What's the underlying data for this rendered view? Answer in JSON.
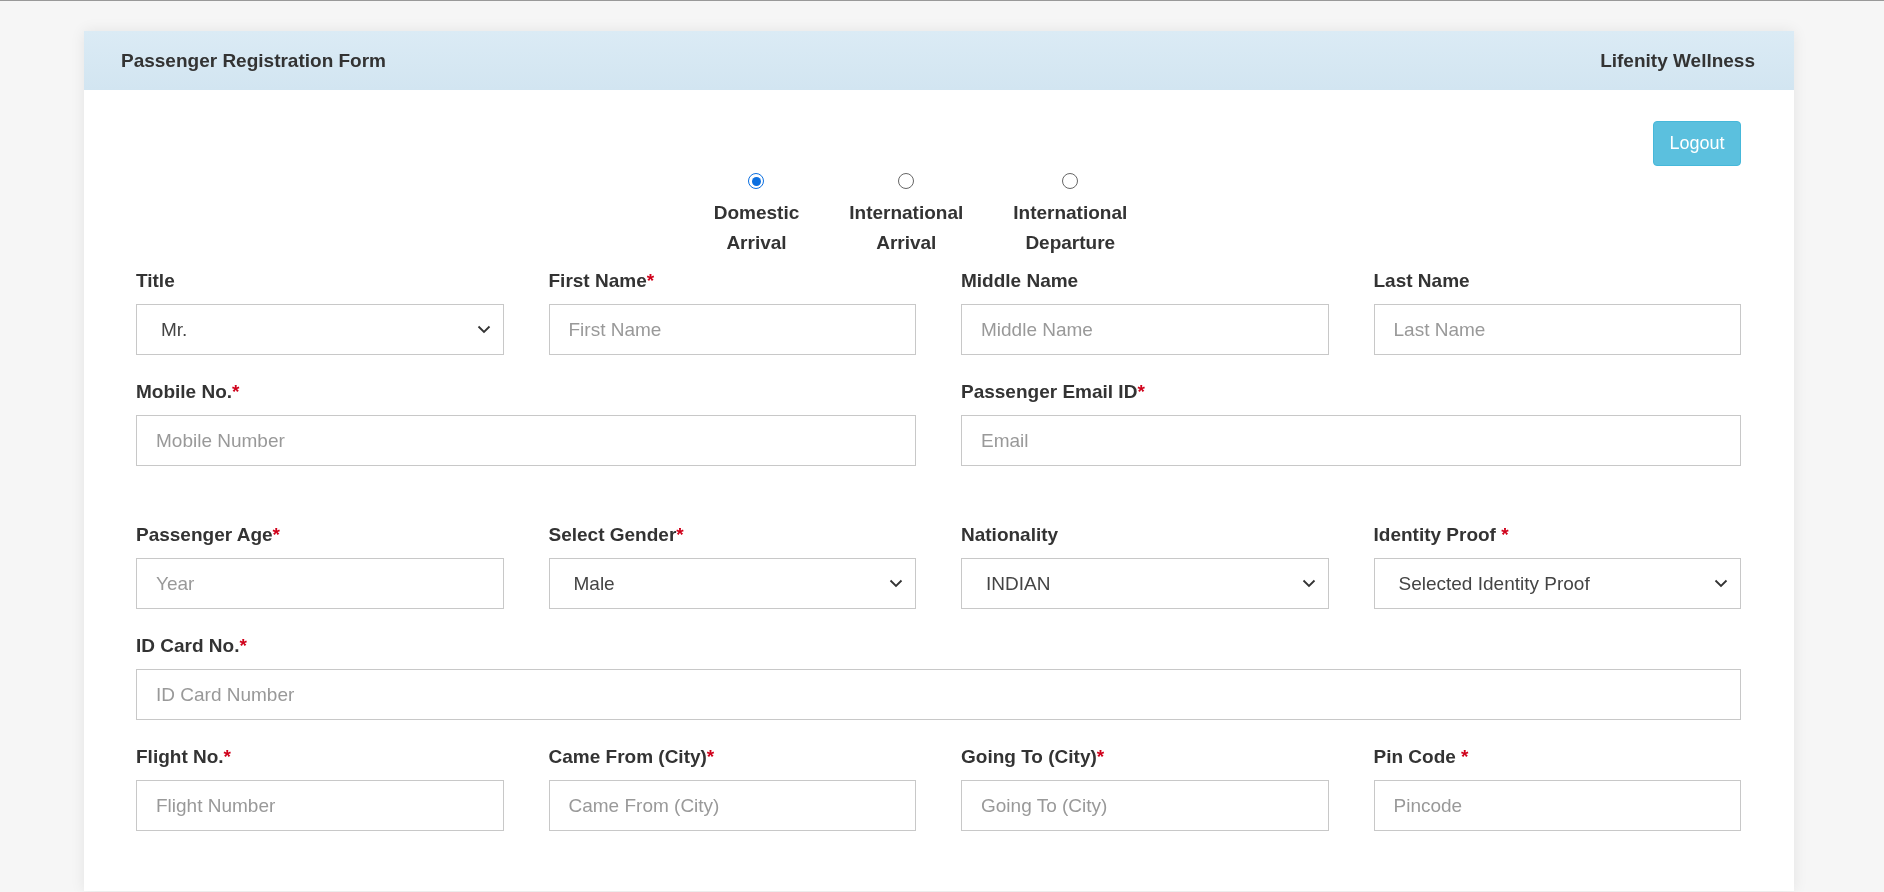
{
  "header": {
    "title": "Passenger Registration Form",
    "brand": "Lifenity Wellness"
  },
  "logout_button": "Logout",
  "travel_type": [
    {
      "label": "Domestic Arrival",
      "selected": true
    },
    {
      "label": "International Arrival",
      "selected": false
    },
    {
      "label": "International Departure",
      "selected": false
    }
  ],
  "form_rows": [
    {
      "fields": [
        {
          "kind": "select",
          "label": "Title",
          "value": "Mr."
        },
        {
          "kind": "input",
          "label": "First Name",
          "required_mark": "*",
          "placeholder": "First Name"
        },
        {
          "kind": "input",
          "label": "Middle Name",
          "placeholder": "Middle Name"
        },
        {
          "kind": "input",
          "label": "Last Name",
          "placeholder": "Last Name"
        }
      ]
    },
    {
      "fields": [
        {
          "kind": "input",
          "label": "Mobile No.",
          "required_mark": "*",
          "placeholder": "Mobile Number"
        },
        {
          "kind": "input",
          "label": "Passenger Email ID",
          "required_mark": "*",
          "placeholder": "Email"
        }
      ]
    },
    {
      "fields": [
        {
          "kind": "input",
          "label": "Passenger Age",
          "required_mark": "*",
          "placeholder": "Year"
        },
        {
          "kind": "select",
          "label": "Select Gender",
          "required_mark": "*",
          "value": "Male"
        },
        {
          "kind": "select",
          "label": "Nationality",
          "value": "INDIAN"
        },
        {
          "kind": "select",
          "label": "Identity Proof",
          "required_mark": " *",
          "value": "Selected Identity Proof"
        }
      ]
    },
    {
      "fields": [
        {
          "kind": "input",
          "label": "ID Card No.",
          "required_mark": "*",
          "placeholder": "ID Card Number"
        }
      ]
    },
    {
      "fields": [
        {
          "kind": "input",
          "label": "Flight No.",
          "required_mark": "*",
          "placeholder": "Flight Number"
        },
        {
          "kind": "input",
          "label": "Came From (City)",
          "required_mark": "*",
          "placeholder": "Came From (City)"
        },
        {
          "kind": "input",
          "label": "Going To (City)",
          "required_mark": "*",
          "placeholder": "Going To (City)"
        },
        {
          "kind": "input",
          "label": "Pin Code",
          "required_mark": " *",
          "placeholder": "Pincode"
        }
      ]
    }
  ]
}
